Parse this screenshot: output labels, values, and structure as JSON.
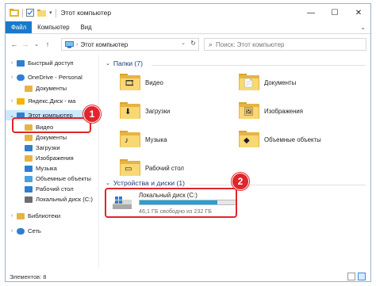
{
  "window": {
    "title": "Этот компьютер",
    "buttons": {
      "minimize": "—",
      "maximize": "☐",
      "close": "✕"
    }
  },
  "ribbon": {
    "tabs": [
      "Файл",
      "Компьютер",
      "Вид"
    ]
  },
  "address": {
    "path": "Этот компьютер",
    "search_placeholder": "Поиск: Этот компьютер"
  },
  "nav": {
    "items": [
      {
        "label": "Быстрый доступ",
        "icon": "star-icon",
        "color": "#2f7fd1"
      },
      {
        "label": "OneDrive - Personal",
        "icon": "cloud-icon",
        "color": "#2f7fd1"
      },
      {
        "label": "Документы",
        "icon": "folder-icon",
        "color": "#e6b441"
      },
      {
        "label": "Яндекс.Диск - ма",
        "icon": "yandex-disk-icon",
        "color": "#f4b400"
      },
      {
        "label": "Этот компьютер",
        "icon": "computer-icon",
        "color": "#2f7fd1"
      },
      {
        "label": "Видео",
        "icon": "video-folder-icon",
        "color": "#e6b441"
      },
      {
        "label": "Документы",
        "icon": "documents-folder-icon",
        "color": "#e6b441"
      },
      {
        "label": "Загрузки",
        "icon": "downloads-folder-icon",
        "color": "#2f7fd1"
      },
      {
        "label": "Изображения",
        "icon": "pictures-folder-icon",
        "color": "#e6b441"
      },
      {
        "label": "Музыка",
        "icon": "music-folder-icon",
        "color": "#2f7fd1"
      },
      {
        "label": "Объемные объекты",
        "icon": "3d-objects-icon",
        "color": "#45a3e0"
      },
      {
        "label": "Рабочий стол",
        "icon": "desktop-folder-icon",
        "color": "#2f7fd1"
      },
      {
        "label": "Локальный диск (C:)",
        "icon": "drive-icon",
        "color": "#6d6d6d"
      },
      {
        "label": "Библиотеки",
        "icon": "libraries-icon",
        "color": "#e6b441"
      },
      {
        "label": "Сеть",
        "icon": "network-icon",
        "color": "#2f7fd1"
      }
    ]
  },
  "folders": {
    "header": "Папки (7)",
    "items": [
      {
        "label": "Видео",
        "symbol": "🎞"
      },
      {
        "label": "Документы",
        "symbol": "📄"
      },
      {
        "label": "Загрузки",
        "symbol": "⬇"
      },
      {
        "label": "Изображения",
        "symbol": "🖼"
      },
      {
        "label": "Музыка",
        "symbol": "♪"
      },
      {
        "label": "Объемные объекты",
        "symbol": "◆"
      },
      {
        "label": "Рабочий стол",
        "symbol": "▭"
      }
    ]
  },
  "devices": {
    "header": "Устройства и диски (1)",
    "drive": {
      "name": "Локальный диск (C:)",
      "free_text": "46,1 ГБ свободно из 232 ГБ",
      "used_fraction": 0.8
    }
  },
  "status": {
    "items_text": "Элементов: 8"
  },
  "callouts": {
    "one": "1",
    "two": "2",
    "color": "#e0252b"
  }
}
